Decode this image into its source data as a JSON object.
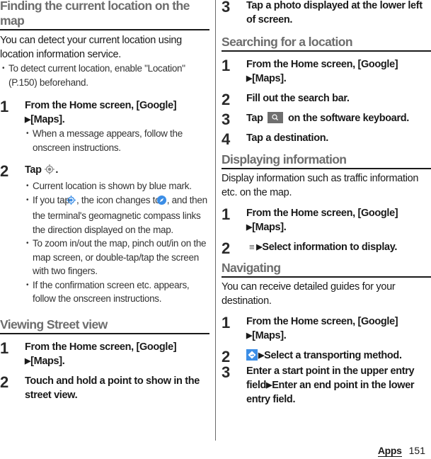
{
  "left": {
    "section1": {
      "title": "Finding the current location on the map",
      "intro": "You can detect your current location using location information service.",
      "note": "To detect current location, enable \"Location\" (P.150) beforehand.",
      "steps": [
        {
          "num": "1",
          "text_a": "From the Home screen, [Google]",
          "text_b": "[Maps].",
          "notes": [
            "When a message appears, follow the onscreen instructions."
          ]
        },
        {
          "num": "2",
          "text_a": "Tap",
          "text_b": ".",
          "notes": [
            "Current location is shown by blue mark.",
            "If you tap",
            ", the icon changes to",
            ", and then the terminal's geomagnetic compass links the direction displayed on the map.",
            "To zoom in/out the map, pinch out/in on the map screen, or double-tap/tap the screen with two fingers.",
            "If the confirmation screen etc. appears, follow the onscreen instructions."
          ]
        }
      ]
    },
    "section2": {
      "title": "Viewing Street view",
      "steps": [
        {
          "num": "1",
          "text_a": "From the Home screen, [Google]",
          "text_b": "[Maps]."
        },
        {
          "num": "2",
          "text": "Touch and hold a point to show in the street view."
        }
      ]
    }
  },
  "right": {
    "cont_step": {
      "num": "3",
      "text": "Tap a photo displayed at the lower left of screen."
    },
    "section3": {
      "title": "Searching for a location",
      "steps": [
        {
          "num": "1",
          "text_a": "From the Home screen, [Google]",
          "text_b": "[Maps]."
        },
        {
          "num": "2",
          "text": "Fill out the search bar."
        },
        {
          "num": "3",
          "text_a": "Tap",
          "text_b": "on the software keyboard."
        },
        {
          "num": "4",
          "text": "Tap a destination."
        }
      ]
    },
    "section4": {
      "title": "Displaying information",
      "intro": "Display information such as traffic information etc. on the map.",
      "steps": [
        {
          "num": "1",
          "text_a": "From the Home screen, [Google]",
          "text_b": "[Maps]."
        },
        {
          "num": "2",
          "text": "Select information to display."
        }
      ]
    },
    "section5": {
      "title": "Navigating",
      "intro": "You can receive detailed guides for your destination.",
      "steps": [
        {
          "num": "1",
          "text_a": "From the Home screen, [Google]",
          "text_b": "[Maps]."
        },
        {
          "num": "2",
          "text": "Select a transporting method."
        },
        {
          "num": "3",
          "text_a": "Enter a start point in the upper entry field",
          "text_b": "Enter an end point in the lower entry field."
        }
      ]
    }
  },
  "glyphs": {
    "arrow": "▶",
    "menu": "≡"
  },
  "colors": {
    "heading": "#6d6d6d",
    "accent_blue": "#3c8ee6",
    "key_gray": "#6f6f6f"
  },
  "footer": {
    "section": "Apps",
    "page": "151"
  }
}
